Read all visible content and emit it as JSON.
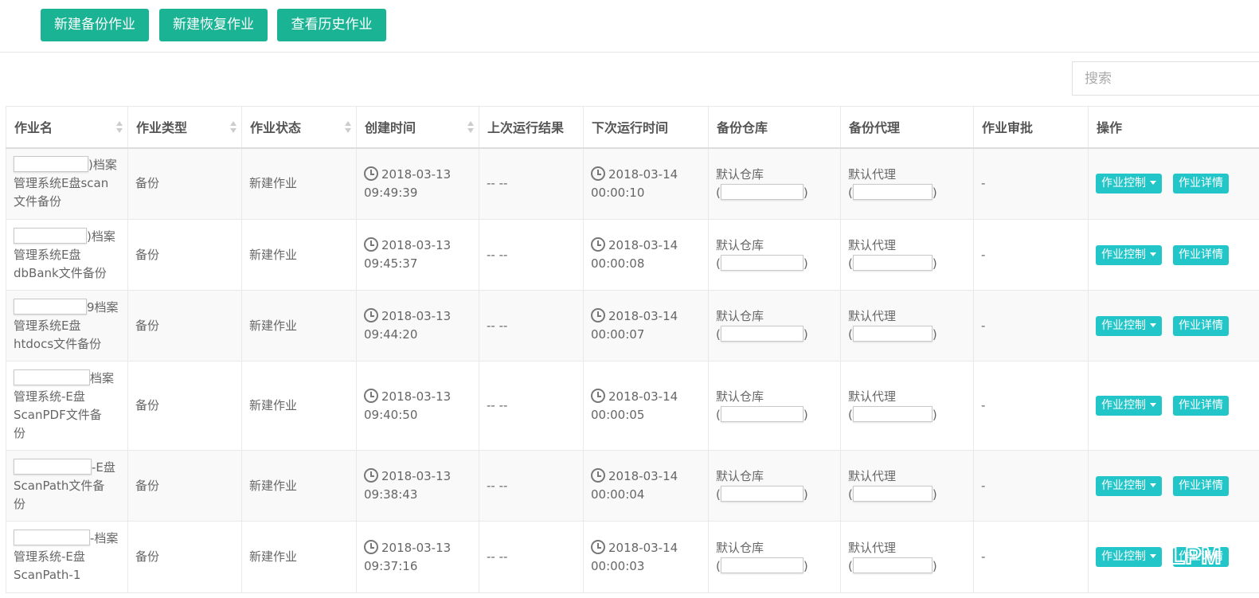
{
  "toolbar": {
    "buttons": [
      "新建备份作业",
      "新建恢复作业",
      "查看历史作业"
    ]
  },
  "search": {
    "placeholder": "搜索"
  },
  "table": {
    "headers": [
      "作业名",
      "作业类型",
      "作业状态",
      "创建时间",
      "上次运行结果",
      "下次运行时间",
      "备份仓库",
      "备份代理",
      "作业审批",
      "操作"
    ],
    "rows": [
      {
        "name_suffix": ")档案",
        "name_lines": [
          "管理系统E盘scan",
          "文件备份"
        ],
        "type": "备份",
        "status": "新建作业",
        "created": [
          "2018-03-13",
          "09:49:39"
        ],
        "last_result": "-- --",
        "next_run": [
          "2018-03-14",
          "00:00:10"
        ],
        "repo": "默认仓库",
        "agent": "默认代理",
        "approval": "-"
      },
      {
        "name_suffix": ")档案",
        "name_lines": [
          "管理系统E盘",
          "dbBank文件备份"
        ],
        "type": "备份",
        "status": "新建作业",
        "created": [
          "2018-03-13",
          "09:45:37"
        ],
        "last_result": "-- --",
        "next_run": [
          "2018-03-14",
          "00:00:08"
        ],
        "repo": "默认仓库",
        "agent": "默认代理",
        "approval": "-"
      },
      {
        "name_suffix": "9档案",
        "name_lines": [
          "管理系统E盘",
          "htdocs文件备份"
        ],
        "type": "备份",
        "status": "新建作业",
        "created": [
          "2018-03-13",
          "09:44:20"
        ],
        "last_result": "-- --",
        "next_run": [
          "2018-03-14",
          "00:00:07"
        ],
        "repo": "默认仓库",
        "agent": "默认代理",
        "approval": "-"
      },
      {
        "name_suffix": "档案",
        "name_lines": [
          "管理系统-E盘",
          "ScanPDF文件备",
          "份"
        ],
        "type": "备份",
        "status": "新建作业",
        "created": [
          "2018-03-13",
          "09:40:50"
        ],
        "last_result": "-- --",
        "next_run": [
          "2018-03-14",
          "00:00:05"
        ],
        "repo": "默认仓库",
        "agent": "默认代理",
        "approval": "-"
      },
      {
        "name_suffix": "-E盘",
        "name_lines": [
          "ScanPath文件备",
          "份"
        ],
        "type": "备份",
        "status": "新建作业",
        "created": [
          "2018-03-13",
          "09:38:43"
        ],
        "last_result": "-- --",
        "next_run": [
          "2018-03-14",
          "00:00:04"
        ],
        "repo": "默认仓库",
        "agent": "默认代理",
        "approval": "-"
      },
      {
        "name_suffix": "-档案",
        "name_lines": [
          "管理系统-E盘",
          "ScanPath-1"
        ],
        "type": "备份",
        "status": "新建作业",
        "created": [
          "2018-03-13",
          "09:37:16"
        ],
        "last_result": "-- --",
        "next_run": [
          "2018-03-14",
          "00:00:03"
        ],
        "repo": "默认仓库",
        "agent": "默认代理",
        "approval": "-"
      }
    ],
    "action_control": "作业控制",
    "action_detail": "作业详情"
  },
  "watermark": {
    "text": "LPM"
  },
  "colors": {
    "primary": "#1ab394",
    "info": "#23c6c8"
  }
}
